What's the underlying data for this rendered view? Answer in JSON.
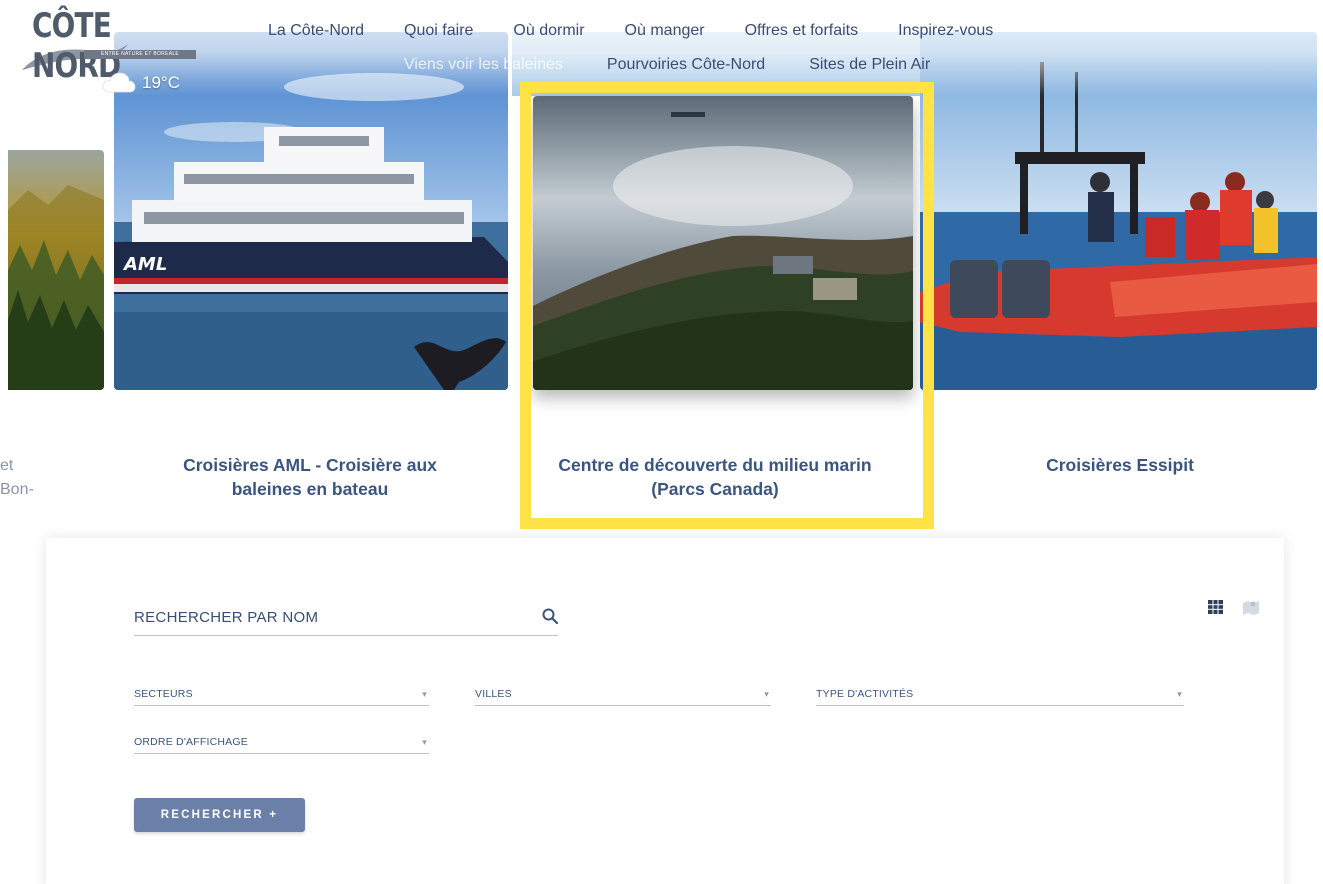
{
  "logo": {
    "text": "CÔTE NORD",
    "tagline": "ENTRE NATURE ET BOREALE"
  },
  "weather": {
    "icon": "cloud-icon",
    "temperature": "19°C"
  },
  "nav": {
    "row1": [
      "La Côte-Nord",
      "Quoi faire",
      "Où dormir",
      "Où manger",
      "Offres et forfaits",
      "Inspirez-vous"
    ],
    "row2": [
      "Viens voir les baleines",
      "Pourvoiries Côte-Nord",
      "Sites de Plein Air"
    ]
  },
  "cards": [
    {
      "title": "et Bon-",
      "partial": true
    },
    {
      "title": "Croisières AML - Croisière aux baleines en bateau"
    },
    {
      "title": "Centre de découverte du milieu marin (Parcs Canada)",
      "highlighted": true
    },
    {
      "title": "Croisières Essipit"
    }
  ],
  "highlight_color": "#ffe245",
  "search": {
    "placeholder": "RECHERCHER PAR NOM",
    "filters": {
      "secteurs": "SECTEURS",
      "villes": "VILLES",
      "type": "TYPE D'ACTIVITÉS",
      "ordre": "ORDRE D'AFFICHAGE"
    },
    "button_label": "RECHERCHER  +"
  },
  "colors": {
    "accent": "#6b80a8",
    "title": "#3a5580"
  }
}
